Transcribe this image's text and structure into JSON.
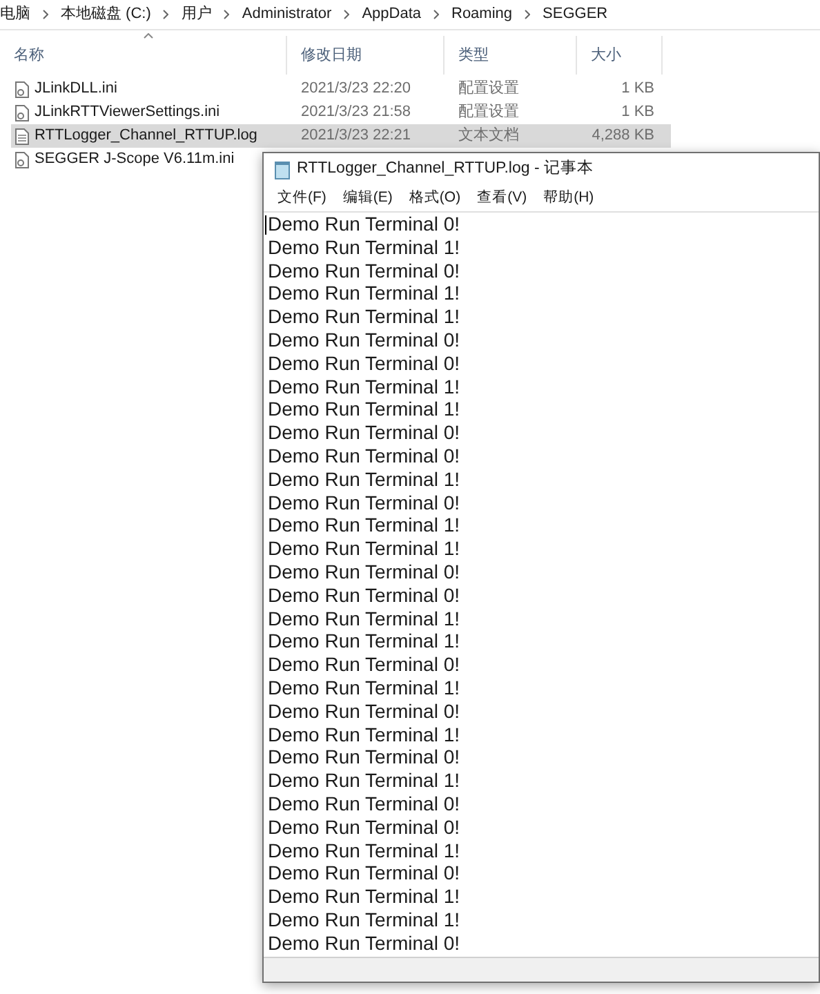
{
  "breadcrumb": [
    "电脑",
    "本地磁盘 (C:)",
    "用户",
    "Administrator",
    "AppData",
    "Roaming",
    "SEGGER"
  ],
  "columns": [
    "名称",
    "修改日期",
    "类型",
    "大小"
  ],
  "files": [
    {
      "name": "JLinkDLL.ini",
      "date": "2021/3/23 22:20",
      "type": "配置设置",
      "size": "1 KB",
      "selected": false,
      "kind": "ini"
    },
    {
      "name": "JLinkRTTViewerSettings.ini",
      "date": "2021/3/23 21:58",
      "type": "配置设置",
      "size": "1 KB",
      "selected": false,
      "kind": "ini"
    },
    {
      "name": "RTTLogger_Channel_RTTUP.log",
      "date": "2021/3/23 22:21",
      "type": "文本文档",
      "size": "4,288 KB",
      "selected": true,
      "kind": "text"
    },
    {
      "name": "SEGGER J-Scope V6.11m.ini",
      "selected": false,
      "kind": "ini"
    }
  ],
  "notepad": {
    "title": "RTTLogger_Channel_RTTUP.log - 记事本",
    "menu": [
      "文件(F)",
      "编辑(E)",
      "格式(O)",
      "查看(V)",
      "帮助(H)"
    ],
    "lines": [
      "Demo Run Terminal 0!",
      "Demo Run Terminal 1!",
      "Demo Run Terminal 0!",
      "Demo Run Terminal 1!",
      "Demo Run Terminal 1!",
      "Demo Run Terminal 0!",
      "Demo Run Terminal 0!",
      "Demo Run Terminal 1!",
      "Demo Run Terminal 1!",
      "Demo Run Terminal 0!",
      "Demo Run Terminal 0!",
      "Demo Run Terminal 1!",
      "Demo Run Terminal 0!",
      "Demo Run Terminal 1!",
      "Demo Run Terminal 1!",
      "Demo Run Terminal 0!",
      "Demo Run Terminal 0!",
      "Demo Run Terminal 1!",
      "Demo Run Terminal 1!",
      "Demo Run Terminal 0!",
      "Demo Run Terminal 1!",
      "Demo Run Terminal 0!",
      "Demo Run Terminal 1!",
      "Demo Run Terminal 0!",
      "Demo Run Terminal 1!",
      "Demo Run Terminal 0!",
      "Demo Run Terminal 0!",
      "Demo Run Terminal 1!",
      "Demo Run Terminal 0!",
      "Demo Run Terminal 1!",
      "Demo Run Terminal 1!",
      "Demo Run Terminal 0!"
    ]
  }
}
